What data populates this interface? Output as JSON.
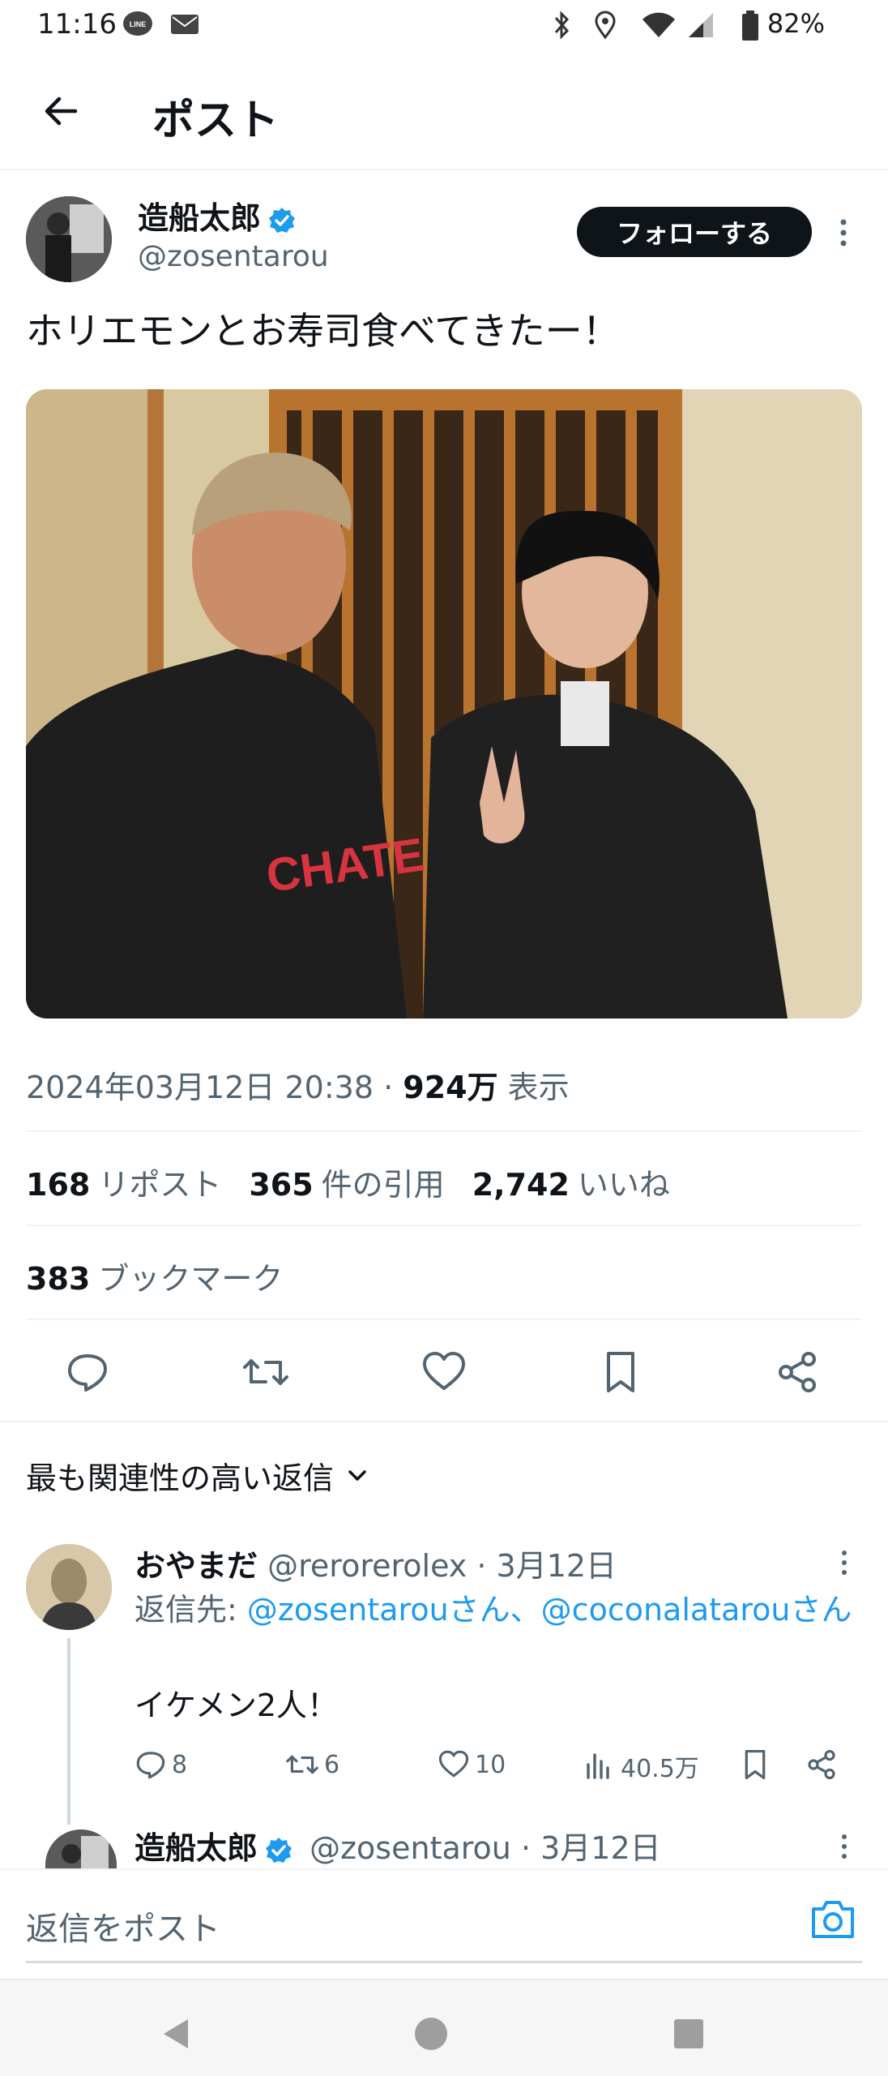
{
  "status_bar": {
    "time": "11:16",
    "battery": "82%"
  },
  "header": {
    "title": "ポスト"
  },
  "tweet": {
    "author_name": "造船太郎",
    "author_handle": "@zosentarou",
    "follow_label": "フォローする",
    "text": "ホリエモンとお寿司食べてきたー！",
    "photo_text": "CHATEAUBRIAND",
    "timestamp": "2024年03月12日 20:38 · ",
    "views_count": "924万",
    "views_label": " 表示",
    "stats": {
      "reposts": "168",
      "reposts_label": "リポスト",
      "quotes": "365",
      "quotes_label": "件の引用",
      "likes": "2,742",
      "likes_label": "いいね"
    },
    "bookmarks": "383",
    "bookmarks_label": "ブックマーク"
  },
  "replies_section": {
    "sort_label": "最も関連性の高い返信"
  },
  "reply": {
    "name": "おやまだ",
    "handle": "@rerorerolex",
    "date": " · 3月12日",
    "reply_to_prefix": "返信先: ",
    "mention1": "@zosentarouさん",
    "sep": "、",
    "mention2": "@coconalatarouさん",
    "text": "イケメン2人！",
    "replies": "8",
    "retweets": "6",
    "likes": "10",
    "views": "40.5万"
  },
  "reply2": {
    "name": "造船太郎",
    "handle": "@zosentarou",
    "date": " · 3月12日"
  },
  "compose": {
    "placeholder": "返信をポスト"
  },
  "colors": {
    "accent": "#1d9bf0",
    "text": "#0f1419",
    "muted": "#536471"
  }
}
